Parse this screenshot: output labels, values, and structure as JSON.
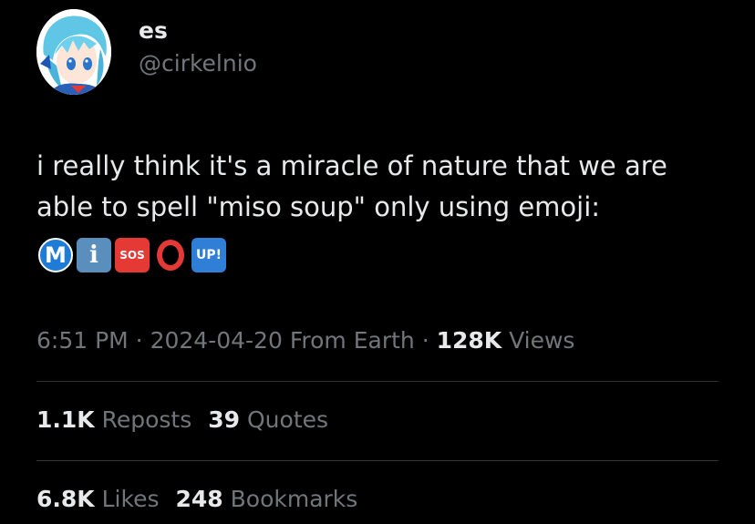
{
  "user": {
    "display_name": "es",
    "handle": "@cirkelnio"
  },
  "tweet": {
    "text_line1": "i really think it's a miracle of nature that we are",
    "text_line2": "able to spell \"miso soup\" only using emoji:",
    "emoji": [
      {
        "name": "m-circled-emoji",
        "label": "M"
      },
      {
        "name": "information-emoji",
        "label": "i"
      },
      {
        "name": "sos-emoji",
        "label": "SOS"
      },
      {
        "name": "o-circle-emoji",
        "label": "O"
      },
      {
        "name": "up-emoji",
        "label": "UP!"
      }
    ]
  },
  "meta": {
    "time": "6:51 PM",
    "separator1": " · ",
    "date": "2024-04-20",
    "source": " From Earth",
    "separator2": " · ",
    "views_count": "128K",
    "views_label": " Views"
  },
  "engagement": {
    "reposts_count": "1.1K",
    "reposts_label": " Reposts",
    "quotes_count": "39",
    "quotes_label": " Quotes",
    "likes_count": "6.8K",
    "likes_label": " Likes",
    "bookmarks_count": "248",
    "bookmarks_label": " Bookmarks"
  },
  "colors": {
    "background": "#000000",
    "primary_text": "#e7e9ea",
    "secondary_text": "#71767b",
    "divider": "#2f3336"
  }
}
